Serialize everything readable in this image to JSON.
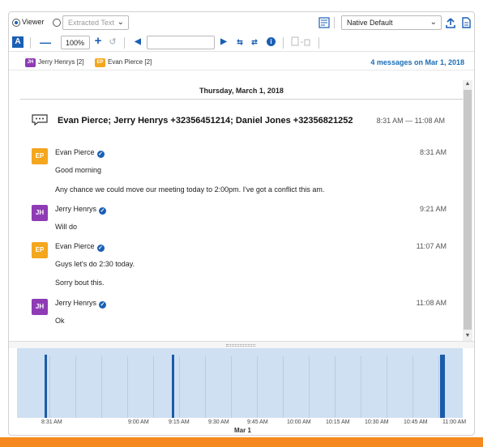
{
  "toolbar": {
    "mode_viewer": "Viewer",
    "mode_extracted": "Extracted Text",
    "zoom": "100%",
    "search_value": "",
    "display_select": "Native Default"
  },
  "participants": [
    {
      "initials": "JH",
      "name": "Jerry Henrys [2]",
      "color": "#8e3bb5"
    },
    {
      "initials": "EP",
      "name": "Evan Pierce [2]",
      "color": "#f4a61d"
    }
  ],
  "message_count": "4 messages on Mar 1, 2018",
  "date_header": "Thursday, March 1, 2018",
  "conversation": {
    "title": "Evan Pierce; Jerry Henrys +32356451214; Daniel Jones +32356821252",
    "time_range": "8:31 AM — 11:08 AM"
  },
  "messages": [
    {
      "initials": "EP",
      "sender": "Evan Pierce",
      "time": "8:31 AM",
      "color": "#f4a61d",
      "lines": [
        "Good morning",
        "Any chance we could move our meeting today to 2:00pm. I've got a conflict this am."
      ]
    },
    {
      "initials": "JH",
      "sender": "Jerry Henrys",
      "time": "9:21 AM",
      "color": "#8e3bb5",
      "lines": [
        "Will do"
      ]
    },
    {
      "initials": "EP",
      "sender": "Evan Pierce",
      "time": "11:07 AM",
      "color": "#f4a61d",
      "lines": [
        "Guys let's do 2:30 today.",
        "Sorry bout this."
      ]
    },
    {
      "initials": "JH",
      "sender": "Jerry Henrys",
      "time": "11:08 AM",
      "color": "#8e3bb5",
      "lines": [
        "Ok"
      ]
    }
  ],
  "timeline": {
    "ticks": [
      "8:31 AM",
      "9:00 AM",
      "9:15 AM",
      "9:30 AM",
      "9:45 AM",
      "10:00 AM",
      "10:15 AM",
      "10:30 AM",
      "10:45 AM",
      "11:00 AM"
    ],
    "date_label": "Mar 1",
    "events_minutes": [
      511,
      561,
      667,
      668
    ]
  },
  "colors": {
    "accent": "#1a5fb4",
    "timeline_bg": "#cfe0f2",
    "event_bar": "#1d5ba8",
    "footer_bar": "#f5891f"
  }
}
